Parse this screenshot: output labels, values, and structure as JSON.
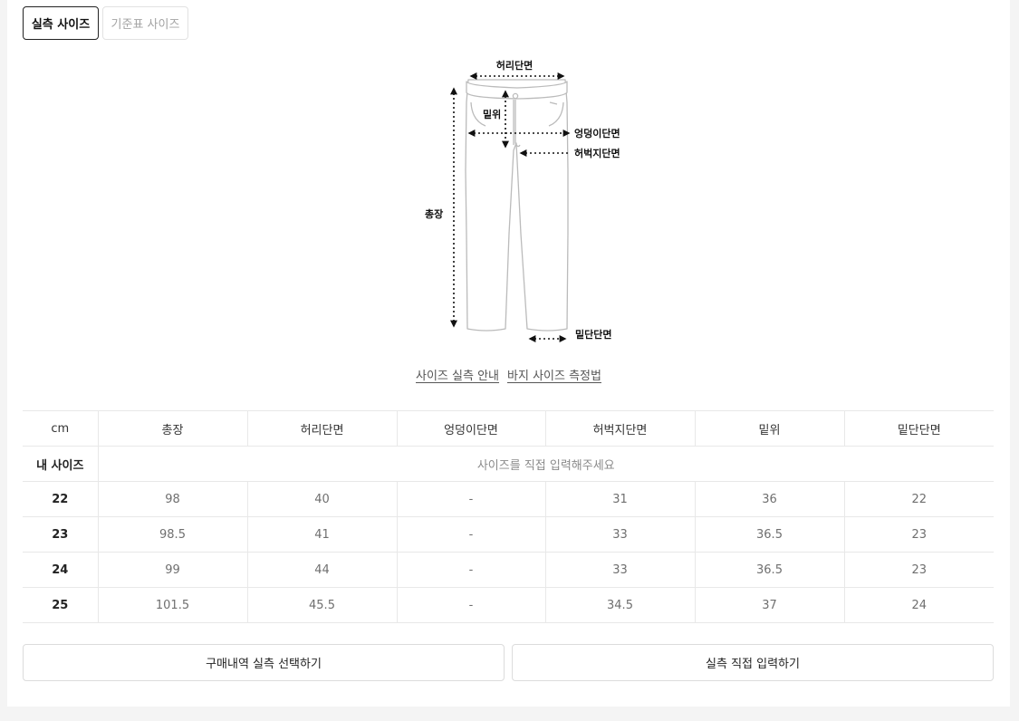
{
  "tabs": [
    {
      "label": "실측 사이즈",
      "active": true
    },
    {
      "label": "기준표 사이즈",
      "active": false
    }
  ],
  "diagram": {
    "waist": "허리단면",
    "rise": "밑위",
    "hip": "엉덩이단면",
    "thigh": "허벅지단면",
    "length": "총장",
    "hem": "밑단단면",
    "icon": "pants-measurement-diagram"
  },
  "guides": {
    "size_guide": "사이즈 실측 안내",
    "pants_measure": "바지 사이즈 측정법"
  },
  "table": {
    "headers": [
      "cm",
      "총장",
      "허리단면",
      "엉덩이단면",
      "허벅지단면",
      "밑위",
      "밑단단면"
    ],
    "my_size": {
      "label": "내 사이즈",
      "prompt": "사이즈를 직접 입력해주세요"
    },
    "rows": [
      {
        "size": "22",
        "values": [
          "98",
          "40",
          "-",
          "31",
          "36",
          "22"
        ]
      },
      {
        "size": "23",
        "values": [
          "98.5",
          "41",
          "-",
          "33",
          "36.5",
          "23"
        ]
      },
      {
        "size": "24",
        "values": [
          "99",
          "44",
          "-",
          "33",
          "36.5",
          "23"
        ]
      },
      {
        "size": "25",
        "values": [
          "101.5",
          "45.5",
          "-",
          "34.5",
          "37",
          "24"
        ]
      }
    ]
  },
  "actions": {
    "purchase_select": "구매내역 실측 선택하기",
    "direct_input": "실측 직접 입력하기"
  }
}
